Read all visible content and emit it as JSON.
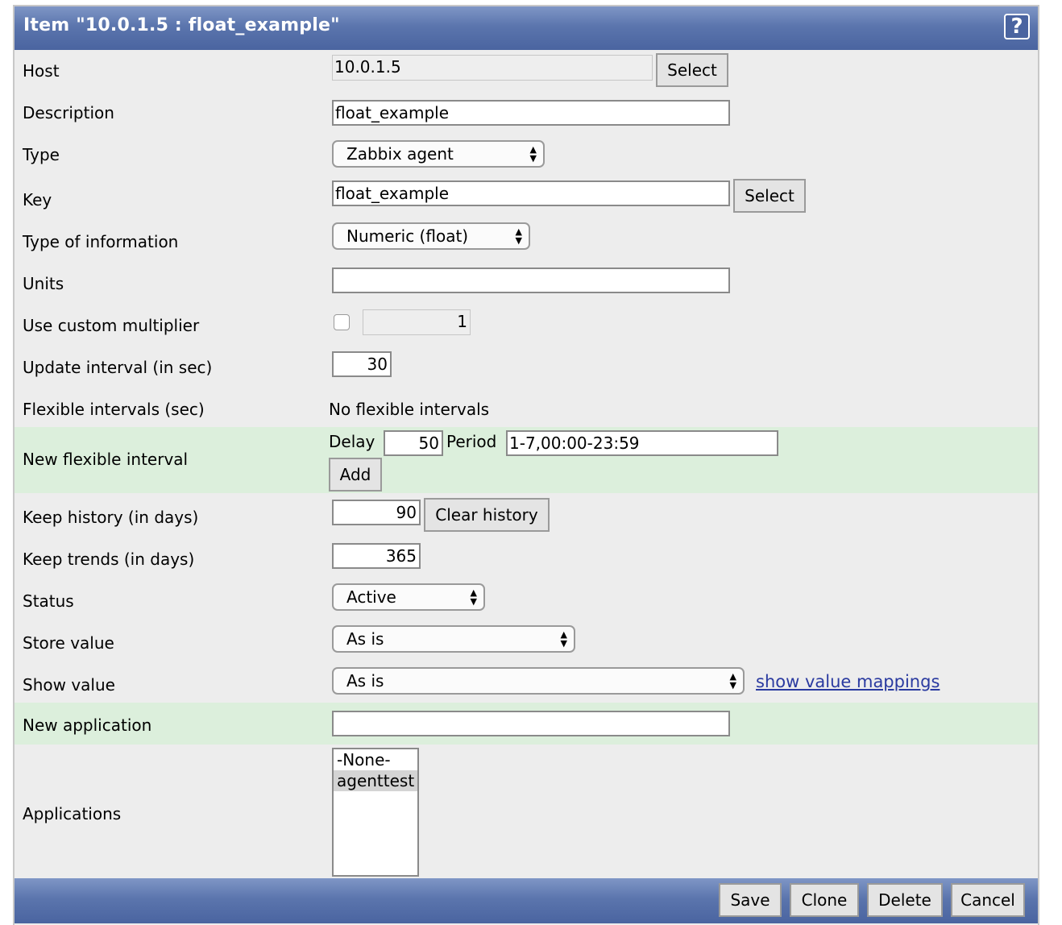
{
  "window": {
    "title": "Item \"10.0.1.5 : float_example\"",
    "help_symbol": "?"
  },
  "form": {
    "host": {
      "label": "Host",
      "value": "10.0.1.5",
      "button": "Select"
    },
    "description": {
      "label": "Description",
      "value": "float_example"
    },
    "type": {
      "label": "Type",
      "value": "Zabbix agent"
    },
    "key": {
      "label": "Key",
      "value": "float_example",
      "button": "Select"
    },
    "type_of_information": {
      "label": "Type of information",
      "value": "Numeric (float)"
    },
    "units": {
      "label": "Units",
      "value": ""
    },
    "custom_multiplier": {
      "label": "Use custom multiplier",
      "checked": false,
      "value": "1"
    },
    "update_interval": {
      "label": "Update interval (in sec)",
      "value": "30"
    },
    "flexible_intervals": {
      "label": "Flexible intervals (sec)",
      "value": "No flexible intervals"
    },
    "new_flexible_interval": {
      "label": "New flexible interval",
      "delay_label": "Delay",
      "delay_value": "50",
      "period_label": "Period",
      "period_value": "1-7,00:00-23:59",
      "add_button": "Add"
    },
    "keep_history": {
      "label": "Keep history (in days)",
      "value": "90",
      "button": "Clear history"
    },
    "keep_trends": {
      "label": "Keep trends (in days)",
      "value": "365"
    },
    "status": {
      "label": "Status",
      "value": "Active"
    },
    "store_value": {
      "label": "Store value",
      "value": "As is"
    },
    "show_value": {
      "label": "Show value",
      "value": "As is",
      "link": "show value mappings"
    },
    "new_application": {
      "label": "New application",
      "value": ""
    },
    "applications": {
      "label": "Applications",
      "options": [
        "-None-",
        "agenttest"
      ],
      "selected": "agenttest"
    }
  },
  "footer": {
    "save": "Save",
    "clone": "Clone",
    "delete": "Delete",
    "cancel": "Cancel"
  }
}
